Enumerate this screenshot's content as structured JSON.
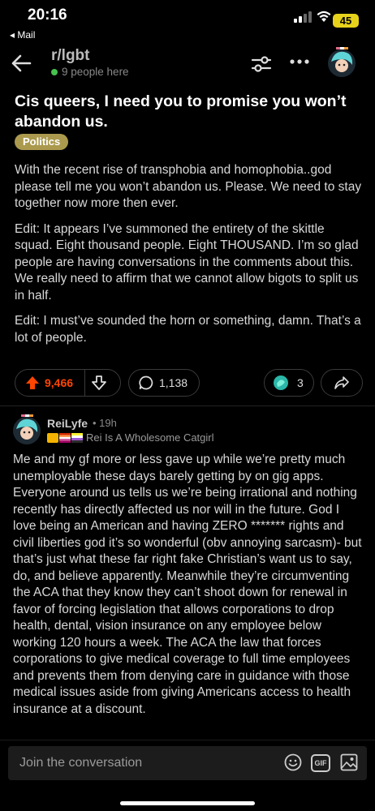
{
  "status_bar": {
    "time": "20:16",
    "back_app": "◂ Mail",
    "battery": "45"
  },
  "header": {
    "subreddit": "r/lgbt",
    "presence": "9 people here"
  },
  "post": {
    "title": "Cis queers, I need you to promise you won’t abandon us.",
    "flair": "Politics",
    "body": [
      "With the recent rise of transphobia and homophobia..god please tell me you won’t abandon us. Please. We need to stay together now more then ever.",
      "Edit: It appears I’ve summoned the entirety of the skittle squad. Eight thousand people. Eight THOUSAND. I’m so glad people are having conversations in the comments about this. We really need to affirm that we cannot allow bigots to split us in half.",
      "Edit: I must’ve sounded the horn or something, damn. That’s a lot of people."
    ],
    "upvotes": "9,466",
    "comments": "1,138",
    "awards": "3"
  },
  "comment": {
    "username": "ReiLyfe",
    "time": "• 19h",
    "flair_text": "Rei Is A Wholesome Catgirl",
    "body": "Me and my gf more or less gave up while we’re pretty much unemployable these days barely getting by on gig apps. Everyone around us tells us we’re being irrational and nothing recently has directly affected us nor will in the future. God I love being an American and having ZERO ******* rights and civil liberties god it’s so wonderful (obv annoying sarcasm)- but that’s just what these far right fake Christian’s want us to say, do, and believe apparently. Meanwhile they’re circumventing the ACA that they know they can’t shoot down for renewal in favor of forcing legislation that allows corporations to drop health, dental, vision insurance on any employee below working 120 hours a week. The ACA the law that forces corporations to give medical coverage to full time employees and prevents them from denying care in guidance with those medical issues aside from giving Americans access to health insurance at a discount."
  },
  "composer": {
    "placeholder": "Join the conversation",
    "gif_label": "GIF"
  },
  "colors": {
    "upvote": "#ff4500",
    "flair": "#ab9a4e",
    "battery": "#e7d21b",
    "online": "#47c14f"
  },
  "icons": [
    "back-arrow-icon",
    "filter-icon",
    "more-icon",
    "upvote-icon",
    "downvote-icon",
    "comment-icon",
    "award-icon",
    "share-icon",
    "emoji-icon",
    "gif-icon",
    "image-icon"
  ]
}
